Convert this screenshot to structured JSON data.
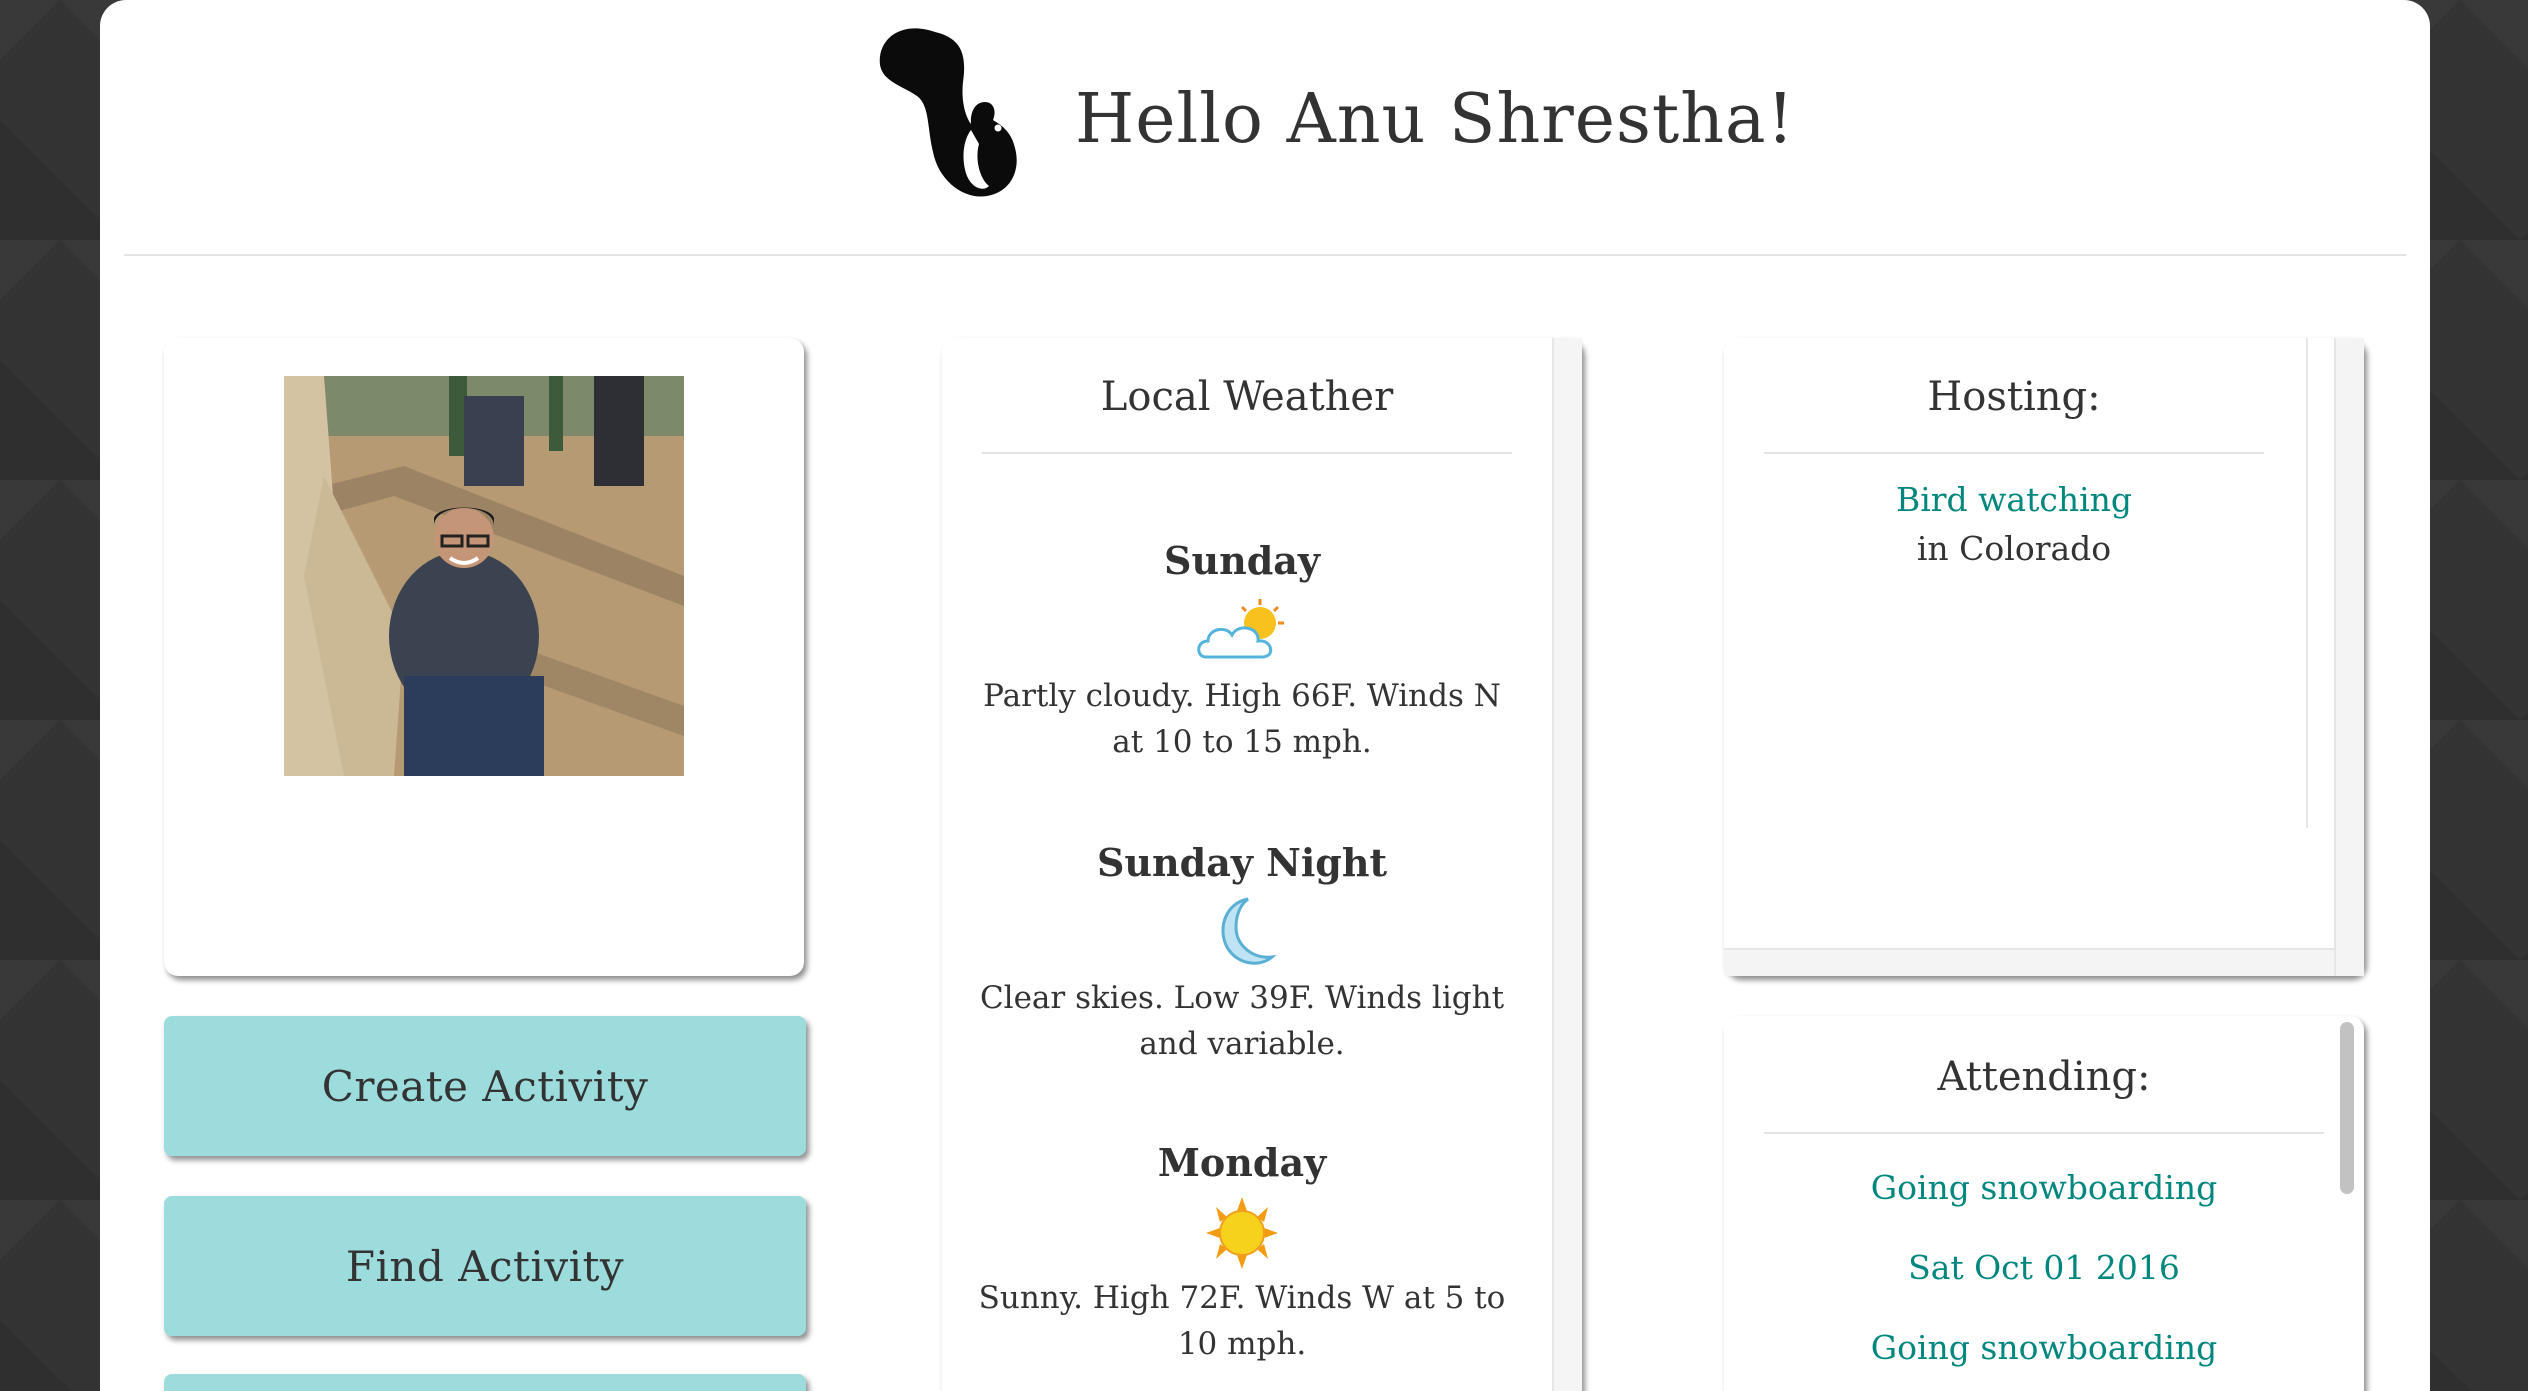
{
  "header": {
    "greeting": "Hello Anu Shrestha!",
    "logo_icon": "squirrel-logo-icon"
  },
  "profile": {
    "photo_description": "profile-photo"
  },
  "actions": {
    "create_label": "Create Activity",
    "find_label": "Find Activity",
    "button_color": "#9ddcdc"
  },
  "weather": {
    "title": "Local Weather",
    "days": [
      {
        "name": "Sunday",
        "icon": "partly-cloudy-icon",
        "description": "Partly cloudy. High 66F. Winds N at 10 to 15 mph."
      },
      {
        "name": "Sunday Night",
        "icon": "moon-icon",
        "description": "Clear skies. Low 39F. Winds light and variable."
      },
      {
        "name": "Monday",
        "icon": "sun-icon",
        "description": "Sunny. High 72F. Winds W at 5 to 10 mph."
      }
    ]
  },
  "hosting": {
    "title": "Hosting:",
    "activity_link": "Bird watching",
    "location": "in Colorado"
  },
  "attending": {
    "title": "Attending:",
    "items": [
      "Going snowboarding",
      "Sat Oct 01 2016",
      "Going snowboarding"
    ]
  },
  "colors": {
    "link": "#00877d",
    "background": "#2f2f2f"
  }
}
